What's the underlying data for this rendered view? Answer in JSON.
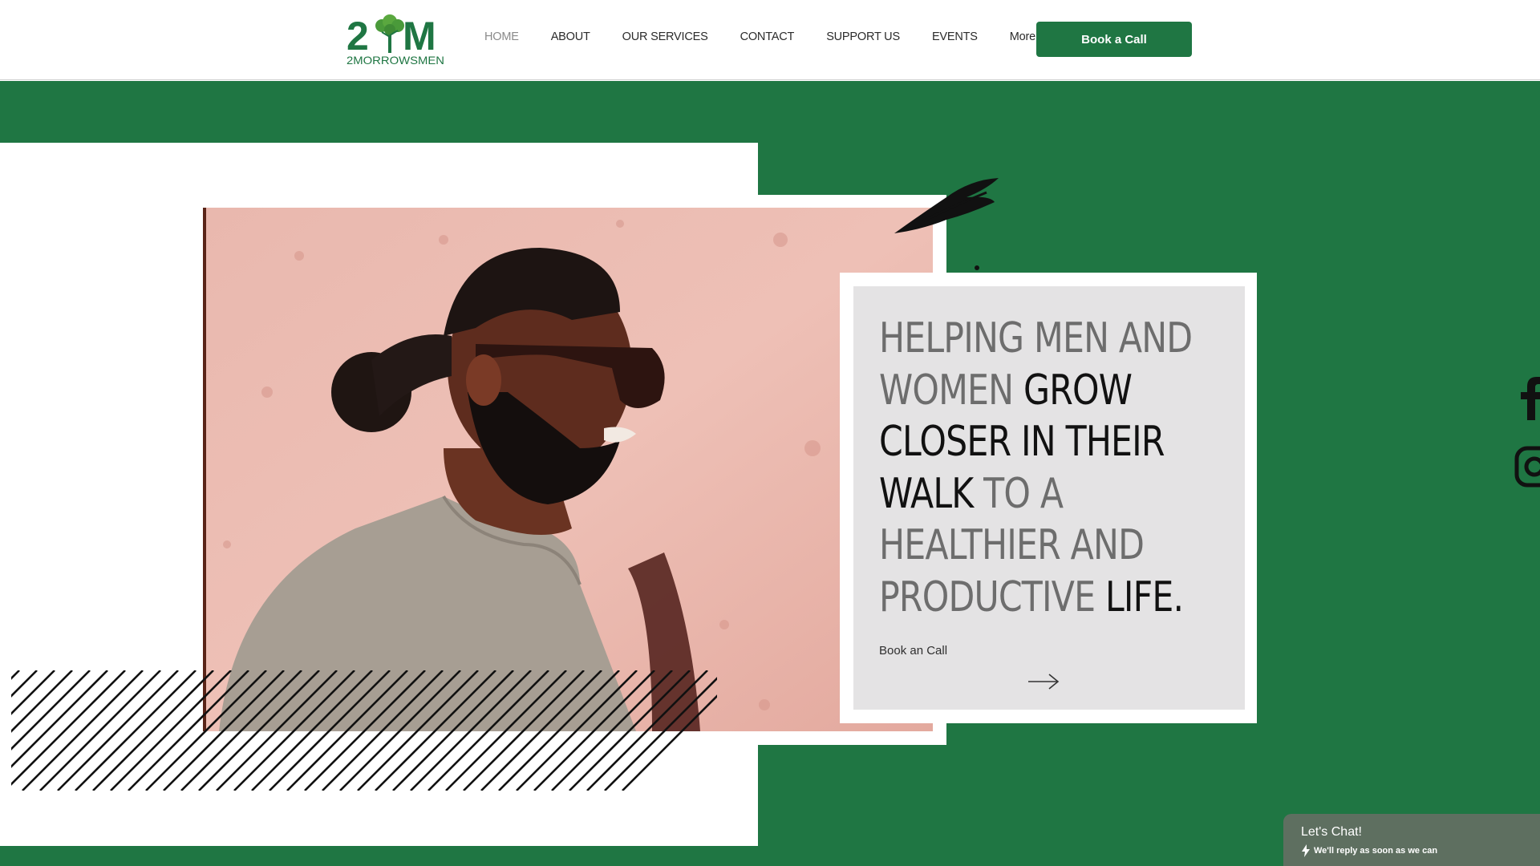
{
  "header": {
    "logo": {
      "big": "2M",
      "small": "2MORROWSMEN"
    },
    "nav": [
      {
        "label": "HOME",
        "active": true
      },
      {
        "label": "ABOUT",
        "active": false
      },
      {
        "label": "OUR SERVICES",
        "active": false
      },
      {
        "label": "CONTACT",
        "active": false
      },
      {
        "label": "SUPPORT US",
        "active": false
      },
      {
        "label": "EVENTS",
        "active": false
      },
      {
        "label": "More",
        "active": false
      }
    ],
    "cta_label": "Book a Call"
  },
  "hero": {
    "headline": [
      {
        "text": "HELPING MEN AND",
        "tone": "grey"
      },
      {
        "text": "WOMEN ",
        "tone": "grey"
      },
      {
        "text": "GROW",
        "tone": "dark"
      },
      {
        "text": "CLOSER IN THEIR",
        "tone": "dark"
      },
      {
        "text": "WALK ",
        "tone": "dark"
      },
      {
        "text": "TO A",
        "tone": "grey"
      },
      {
        "text": "HEALTHIER AND",
        "tone": "grey"
      },
      {
        "text": "PRODUCTIVE ",
        "tone": "grey"
      },
      {
        "text": "LIFE.",
        "tone": "dark"
      }
    ],
    "card_link": "Book an Call"
  },
  "social": [
    "facebook-icon",
    "instagram-icon"
  ],
  "chat": {
    "title": "Let's Chat!",
    "subtitle": "We'll reply as soon as we can"
  },
  "colors": {
    "brand_green": "#1f7643",
    "card_grey": "#e4e3e4",
    "chat_bg": "#5e6f60"
  }
}
